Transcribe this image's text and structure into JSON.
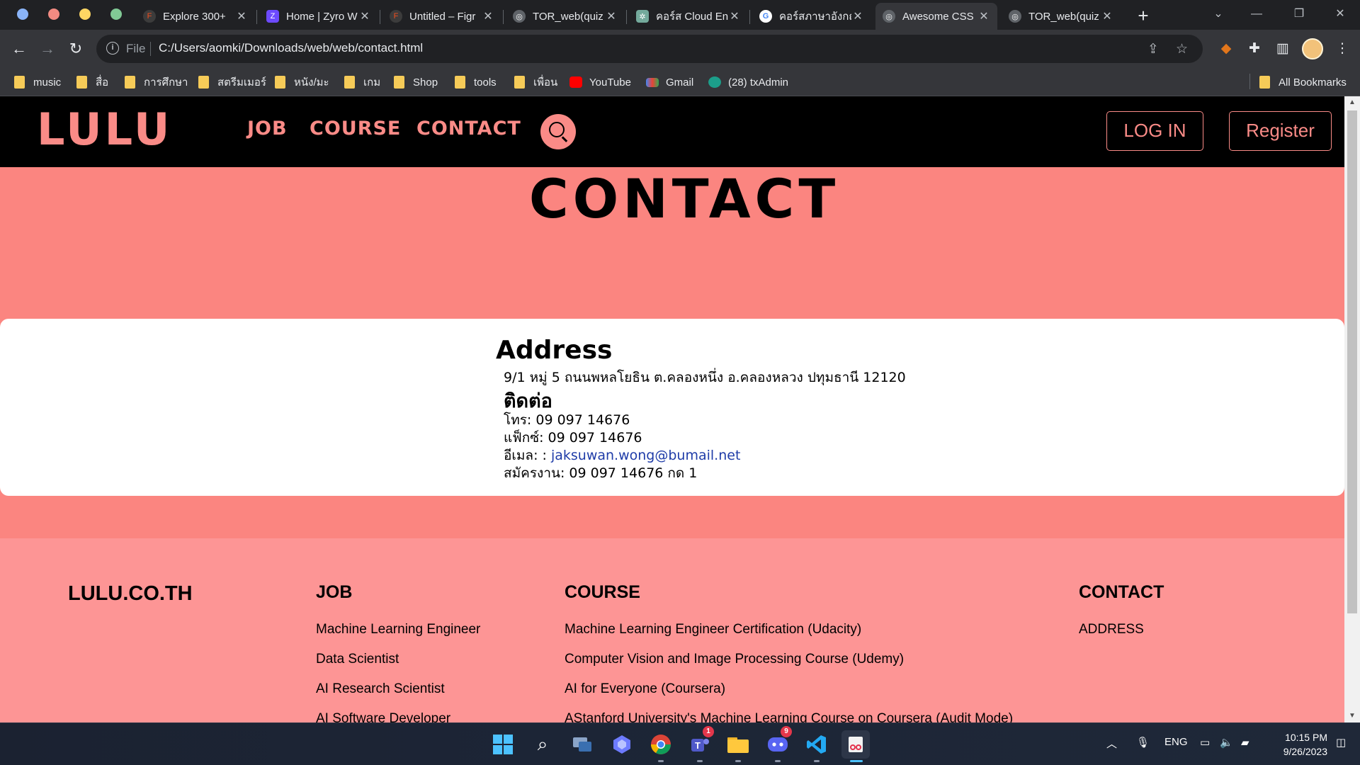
{
  "browser": {
    "tabs": [
      {
        "title": "Explore 300+ ",
        "icon": "figma-icon"
      },
      {
        "title": "Home | Zyro W",
        "icon": "zyro-icon"
      },
      {
        "title": "Untitled – Figr",
        "icon": "figma-icon"
      },
      {
        "title": "TOR_web(quiz",
        "icon": "globe-icon"
      },
      {
        "title": "คอร์ส Cloud En",
        "icon": "chatgpt-icon"
      },
      {
        "title": "คอร์สภาษาอังกฤ",
        "icon": "google-icon"
      },
      {
        "title": "Awesome CSS",
        "icon": "globe-icon",
        "active": true
      },
      {
        "title": "TOR_web(quiz",
        "icon": "globe-icon"
      }
    ],
    "omnibox": {
      "scheme": "File",
      "url": "C:/Users/aomki/Downloads/web/web/contact.html"
    },
    "bookmarks": [
      {
        "label": "music",
        "type": "folder"
      },
      {
        "label": "สื่อ",
        "type": "folder"
      },
      {
        "label": "การศึกษา",
        "type": "folder"
      },
      {
        "label": "สตรีมเมอร์",
        "type": "folder"
      },
      {
        "label": "หนัง/มะ",
        "type": "folder"
      },
      {
        "label": "เกม",
        "type": "folder"
      },
      {
        "label": "Shop",
        "type": "folder"
      },
      {
        "label": "tools",
        "type": "folder"
      },
      {
        "label": "เพื่อน",
        "type": "folder"
      },
      {
        "label": "YouTube",
        "type": "youtube"
      },
      {
        "label": "Gmail",
        "type": "gmail"
      },
      {
        "label": "(28) txAdmin",
        "type": "txadmin"
      }
    ],
    "all_bookmarks": "All Bookmarks"
  },
  "site": {
    "logo": "LULU",
    "nav": {
      "job": "JOB",
      "course": "COURSE",
      "contact": "CONTACT"
    },
    "login": "LOG IN",
    "register": "Register",
    "page_title": "CONTACT",
    "address_heading": "Address",
    "address_line": "9/1 หมู่ 5 ถนนพหลโยธิน ต.คลองหนึ่ง อ.คลองหลวง ปทุมธานี 12120",
    "contact_heading": "ติดต่อ",
    "phone": "โทร: 09 097 14676",
    "fax": "แฟ็กซ์: 09 097 14676",
    "email_label": "อีเมล: : ",
    "email": "jaksuwan.wong@bumail.net",
    "apply": "สมัครงาน: 09 097 14676 กด 1",
    "footer": {
      "brand": "LULU.CO.TH",
      "job_heading": "JOB",
      "jobs": [
        "Machine Learning Engineer",
        "Data Scientist",
        "AI Research Scientist",
        "AI Software Developer"
      ],
      "course_heading": "COURSE",
      "courses": [
        "Machine Learning Engineer Certification (Udacity)",
        "Computer Vision and Image Processing Course (Udemy)",
        "AI for Everyone (Coursera)",
        "AStanford University's Machine Learning Course on Coursera (Audit Mode)"
      ],
      "contact_heading": "CONTACT",
      "contact_items": [
        "ADDRESS"
      ]
    },
    "colors": {
      "accent": "#fa8b87",
      "nav_bg": "#000000",
      "page_bg": "#fb8580",
      "footer_bg": "#fd9595"
    }
  },
  "taskbar": {
    "tray": {
      "lang": "ENG"
    },
    "clock": {
      "time": "10:15 PM",
      "date": "9/26/2023"
    },
    "badges": {
      "teams": "1",
      "discord": "9"
    }
  }
}
